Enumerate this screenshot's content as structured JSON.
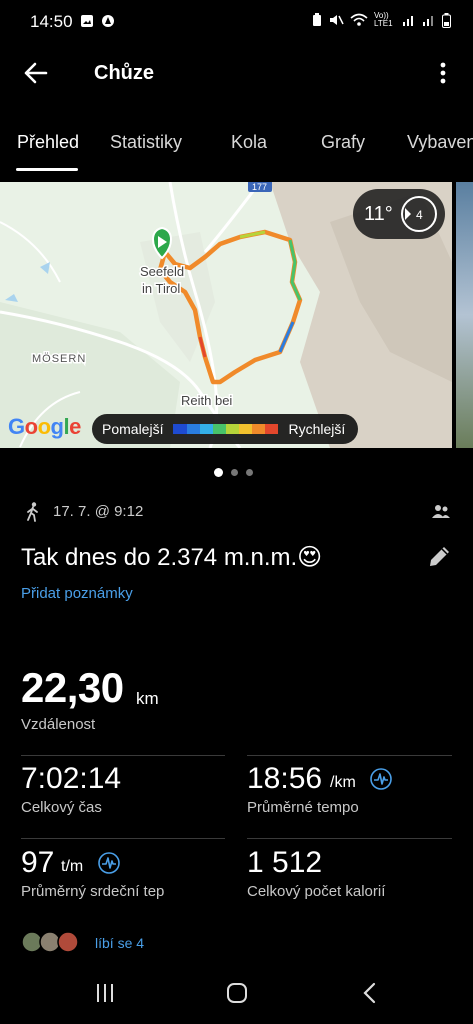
{
  "status_bar": {
    "time": "14:50",
    "network_label": "Vo)) LTE1"
  },
  "app_bar": {
    "title": "Chůze",
    "back_icon": "arrow-left-icon",
    "more_icon": "more-vertical-icon"
  },
  "tabs": [
    {
      "label": "Přehled",
      "active": true
    },
    {
      "label": "Statistiky",
      "active": false
    },
    {
      "label": "Kola",
      "active": false
    },
    {
      "label": "Grafy",
      "active": false
    },
    {
      "label": "Vybaven",
      "active": false
    }
  ],
  "map": {
    "place_labels": [
      "Seefeld",
      "in Tirol",
      "MÖSERN",
      "Reith bei"
    ],
    "road_number": "177",
    "weather_temp": "11°",
    "wind_value": "4",
    "google_label": "Google",
    "pace_slower": "Pomalejší",
    "pace_faster": "Rychlejší",
    "pace_colors": [
      "#1e4bd1",
      "#2a7de0",
      "#34b0e8",
      "#48c36a",
      "#b6d43a",
      "#f2c12e",
      "#f08a2a",
      "#e3472c"
    ],
    "start_marker_color": "#2ca84a"
  },
  "pager": {
    "pages": 3,
    "current": 1
  },
  "activity": {
    "date": "17. 7. @ 9:12",
    "title": "Tak dnes do 2.374 m.n.m.😍",
    "add_notes": "Přidat poznámky"
  },
  "stats": {
    "distance": {
      "value": "22,30",
      "unit": "km",
      "label": "Vzdálenost"
    },
    "total_time": {
      "value": "7:02:14",
      "label": "Celkový čas"
    },
    "avg_pace": {
      "value": "18:56",
      "unit": "/km",
      "label": "Průměrné tempo"
    },
    "avg_hr": {
      "value": "97",
      "unit": "t/m",
      "label": "Průměrný srdeční tep"
    },
    "calories": {
      "value": "1 512",
      "label": "Celkový počet kalorií"
    }
  },
  "likes": {
    "text": "líbí se 4"
  },
  "colors": {
    "accent": "#4a9fe8",
    "background": "#000000"
  }
}
